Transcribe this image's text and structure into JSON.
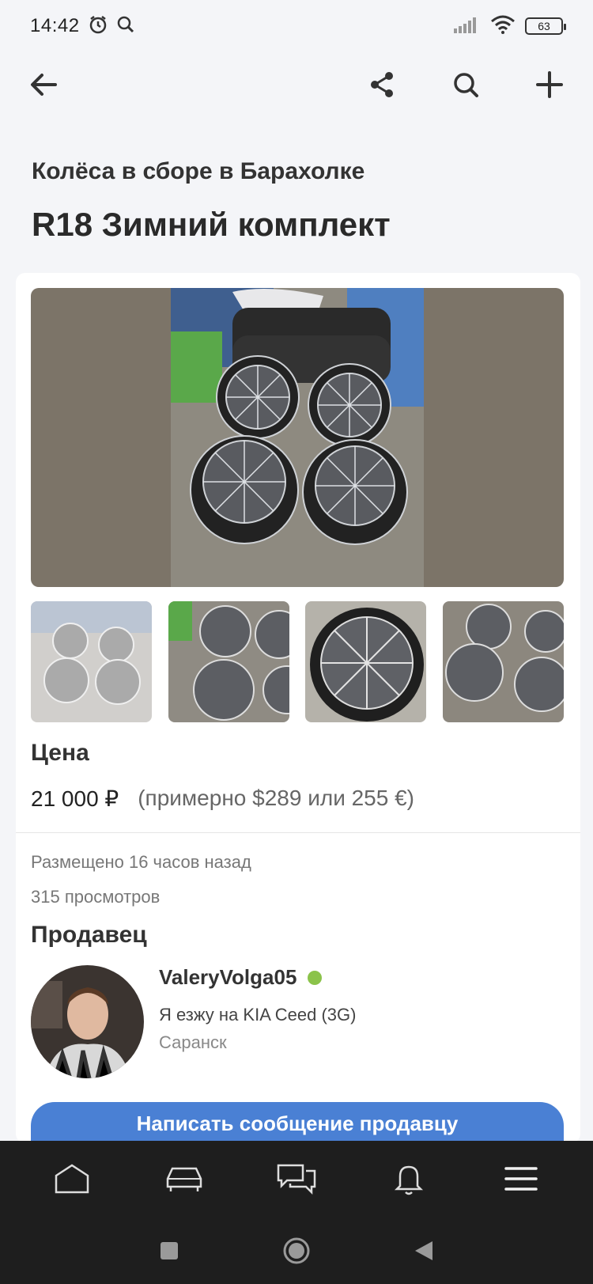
{
  "status_bar": {
    "time": "14:42",
    "battery": "63",
    "icons": [
      "alarm-icon",
      "search-icon",
      "signal-icon",
      "wifi-icon",
      "battery-icon"
    ]
  },
  "app_bar": {
    "back_icon": "arrow-left-icon",
    "actions": [
      "share-icon",
      "search-icon",
      "plus-icon"
    ]
  },
  "listing": {
    "category": "Колёса в сборе в Барахолке",
    "title": "R18 Зимний комплект"
  },
  "photos": {
    "main": "wheels-photo",
    "thumbnails": [
      "thumb-1",
      "thumb-2",
      "thumb-3",
      "thumb-4"
    ]
  },
  "price": {
    "label": "Цена",
    "value": "21 000 ₽",
    "approx": "(примерно $289 или 255 €)"
  },
  "meta": {
    "posted": "Размещено 16 часов назад",
    "views": "315 просмотров"
  },
  "seller": {
    "label": "Продавец",
    "name": "ValeryVolga05",
    "online": true,
    "car": "Я езжу на KIA Ceed (3G)",
    "city": "Саранск"
  },
  "actions": {
    "message_button": "Написать сообщение продавцу"
  },
  "bottom_nav": [
    "home-icon",
    "car-icon",
    "messages-icon",
    "bell-icon",
    "menu-icon"
  ],
  "system_nav": [
    "recents-icon",
    "home-circle-icon",
    "back-triangle-icon"
  ],
  "colors": {
    "accent": "#4a80d4",
    "online": "#8bc34a",
    "nav_bg": "#1e1e1e",
    "photo_bg": "#7c7468"
  }
}
